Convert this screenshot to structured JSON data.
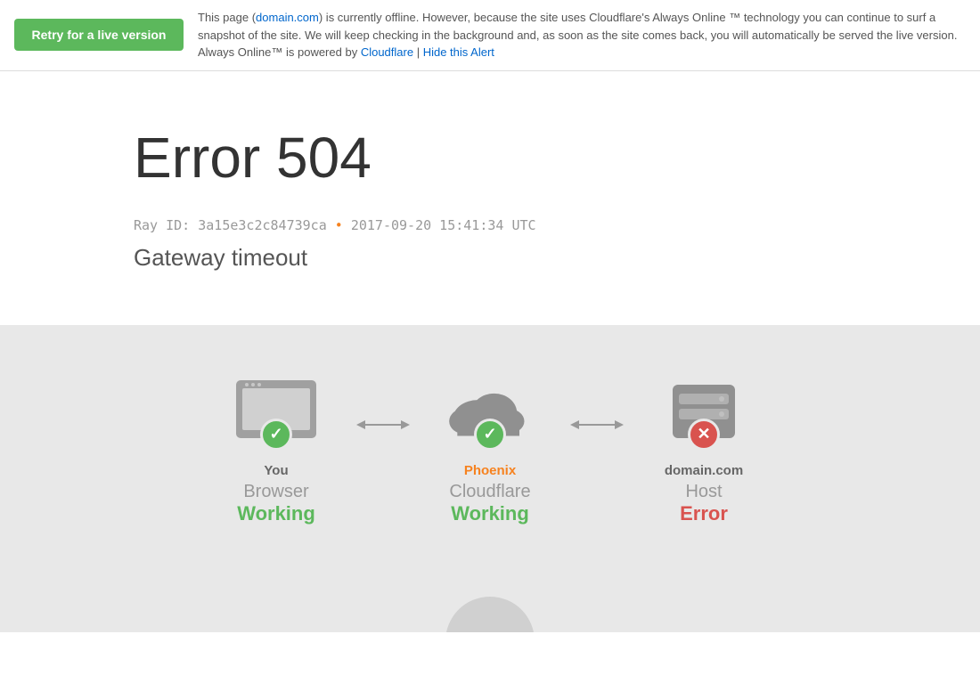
{
  "banner": {
    "retry_label": "Retry for a live version",
    "message_before_link": "This page (",
    "domain_link_text": "domain.com",
    "domain_link_url": "#",
    "message_after_link": ") is currently offline. However, because the site uses Cloudflare's Always Online ™ technology you can continue to surf a snapshot of the site. We will keep checking in the background and, as soon as the site comes back, you will automatically be served the live version.",
    "always_online_text": "Always Online™ is powered by ",
    "cloudflare_link_text": "Cloudflare",
    "cloudflare_link_url": "#",
    "separator": " | ",
    "hide_alert_text": "Hide this Alert",
    "hide_alert_url": "#"
  },
  "error": {
    "title": "Error 504",
    "ray_id": "Ray ID: 3a15e3c2c84739ca",
    "bullet": "•",
    "timestamp": "2017-09-20 15:41:34 UTC",
    "subtitle": "Gateway timeout"
  },
  "diagram": {
    "nodes": [
      {
        "id": "you",
        "name": "You",
        "label": "Browser",
        "status": "Working",
        "status_type": "ok",
        "name_color": "gray"
      },
      {
        "id": "phoenix",
        "name": "Phoenix",
        "label": "Cloudflare",
        "status": "Working",
        "status_type": "ok",
        "name_color": "orange"
      },
      {
        "id": "host",
        "name": "domain.com",
        "label": "Host",
        "status": "Error",
        "status_type": "err",
        "name_color": "gray"
      }
    ]
  }
}
